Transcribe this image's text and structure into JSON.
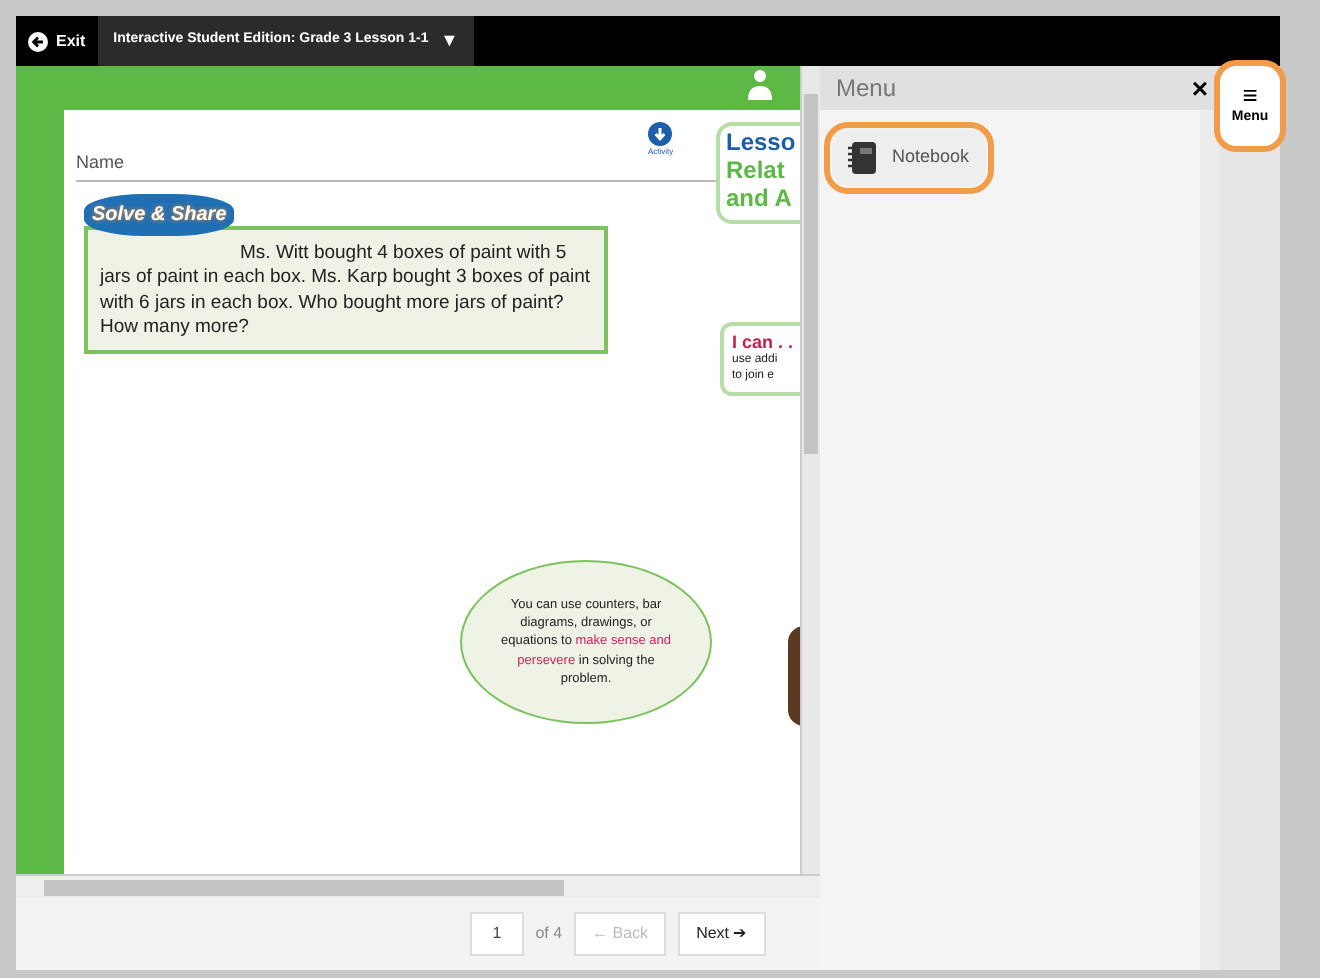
{
  "toolbar": {
    "exit_label": "Exit",
    "title": "Interactive Student Edition: Grade 3 Lesson 1-1",
    "title_caret": "▼"
  },
  "page": {
    "name_label": "Name",
    "activity_label": "Activity",
    "logo": "Solve & Share",
    "problem": "Ms. Witt bought 4 boxes of paint with 5 jars of paint in each box. Ms. Karp bought 3 boxes of paint with 6 jars in each box. Who bought more jars of paint? How many more?",
    "lesson_card": [
      "Lesso",
      "Relat",
      "and A"
    ],
    "i_can": {
      "heading": "I can . .",
      "lines": [
        "use addi",
        "to join e"
      ]
    },
    "bubble": "You can use counters, bar diagrams, drawings, or equations to **make sense and persevere** in solving the problem."
  },
  "pager": {
    "page": "1",
    "of": "of 4",
    "back": {
      "label": "← Back",
      "disabled": true
    },
    "next": {
      "label": "Next ➔",
      "disabled": false
    }
  },
  "menu_panel": {
    "title": "Menu",
    "close": "×",
    "items": [
      {
        "label": "Notebook",
        "highlighted": true
      }
    ]
  },
  "menu_button": {
    "label": "Menu",
    "icon": "≡",
    "highlighted": true
  }
}
